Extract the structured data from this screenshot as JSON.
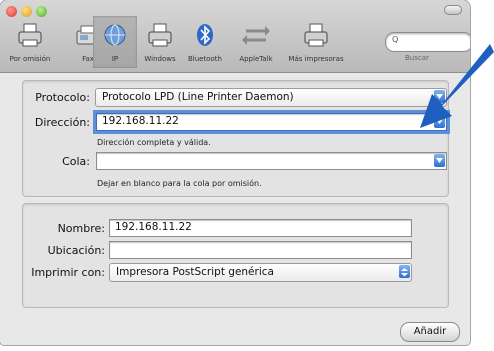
{
  "toolbar": {
    "tools": [
      {
        "label": "Por omisión",
        "icon": "default-printer-icon"
      },
      {
        "label": "Fax",
        "icon": "fax-icon"
      },
      {
        "label": "IP",
        "icon": "ip-globe-icon"
      },
      {
        "label": "Windows",
        "icon": "windows-printer-icon"
      },
      {
        "label": "Bluetooth",
        "icon": "bluetooth-icon"
      },
      {
        "label": "AppleTalk",
        "icon": "appletalk-arrows-icon"
      },
      {
        "label": "Más impresoras",
        "icon": "more-printers-icon"
      }
    ],
    "selected": "IP",
    "search_placeholder": "Buscar"
  },
  "form": {
    "protocol_label": "Protocolo:",
    "protocol_value": "Protocolo LPD (Line Printer Daemon)",
    "address_label": "Dirección:",
    "address_value": "192.168.11.22",
    "address_hint": "Dirección completa y válida.",
    "queue_label": "Cola:",
    "queue_value": "",
    "queue_hint": "Dejar en blanco para la cola por omisión."
  },
  "details": {
    "name_label": "Nombre:",
    "name_value": "192.168.11.22",
    "location_label": "Ubicación:",
    "location_value": "",
    "print_with_label": "Imprimir con:",
    "print_with_value": "Impresora PostScript genérica"
  },
  "add_button": "Añadir",
  "colors": {
    "accent": "#2f6fd3",
    "arrow": "#1f5fbf"
  }
}
